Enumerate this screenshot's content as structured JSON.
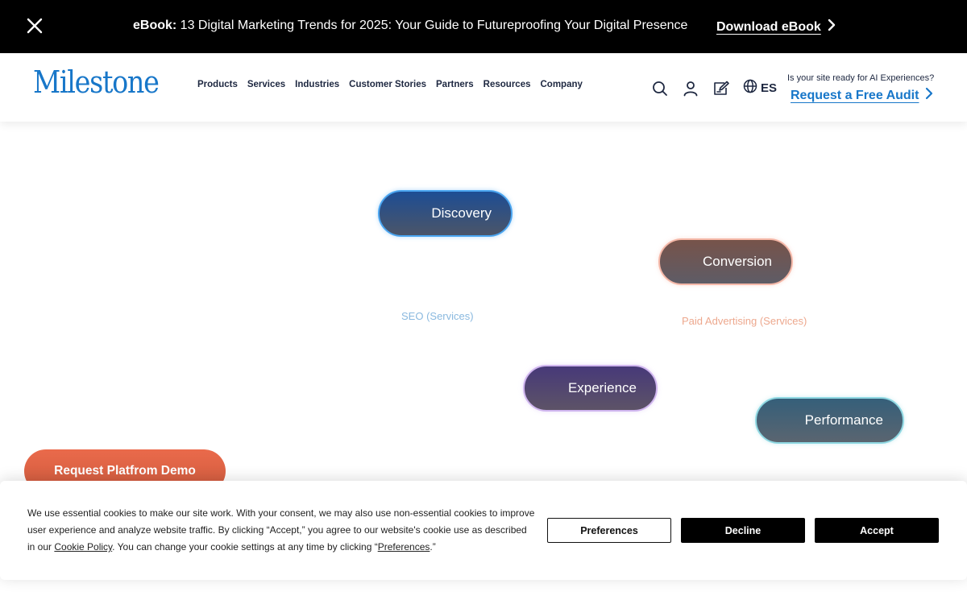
{
  "promo": {
    "bold": "eBook:",
    "text": " 13 Digital Marketing Trends for 2025: Your Guide to Futureproofing Your Digital Presence",
    "cta": "Download eBook"
  },
  "header": {
    "logo": "Milestone",
    "nav": [
      "Products",
      "Services",
      "Industries",
      "Customer Stories",
      "Partners",
      "Resources",
      "Company"
    ],
    "lang": "ES",
    "audit_question": "Is your site ready for AI Experiences?",
    "audit_link": "Request a Free Audit"
  },
  "main": {
    "pills": {
      "discovery": "Discovery",
      "conversion": "Conversion",
      "experience": "Experience",
      "performance": "Performance"
    },
    "services": {
      "seo": "SEO (Services)",
      "paid": "Paid Advertising (Services)"
    },
    "demo_button": "Request Platfrom Demo"
  },
  "cookie": {
    "text_1": "We use essential cookies to make our site work. With your consent, we may also use non-essential cookies to improve user experience and analyze website traffic. By clicking “Accept,” you agree to our website's cookie use as described in our ",
    "policy_link": "Cookie Policy",
    "text_2": ". You can change your cookie settings at any time by clicking “",
    "pref_link": "Preferences",
    "text_3": ".”",
    "preferences": "Preferences",
    "decline": "Decline",
    "accept": "Accept"
  },
  "colors": {
    "brand_blue": "#1877c9",
    "demo_orange": "#ea6a4b",
    "nav_text": "#1d2740"
  }
}
